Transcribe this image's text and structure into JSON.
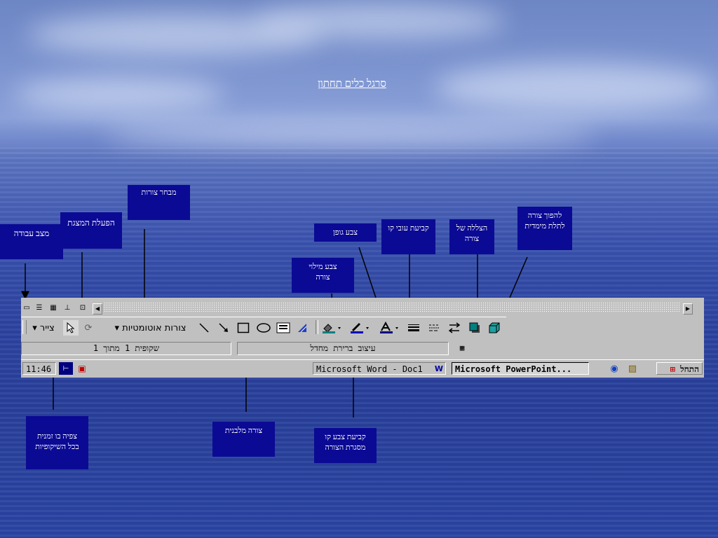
{
  "slide_title": "סרגל כלים תחתון",
  "labels": {
    "shapes_selector": "מבחר צורות",
    "work_mode": "מצב עבודה",
    "run_show": "הפעלת המצגת",
    "font_color": "צבע גופן",
    "fill_color": "צבע מילוי צורה",
    "line_thickness": "קביעת עובי קו",
    "shadow": "הצללה של צורה",
    "three_d": "להפוך צורה לתלת מימדית",
    "preview_transparencies": "צפיה בו זמנית בכל השיקופיות",
    "rectangle": "צורה מלבנית",
    "line_color": "קביעת צבע קו מסגרת הצורה"
  },
  "toolbar": {
    "draw_menu": "צייר",
    "autoshapes_menu": "צורות אוטומטיות",
    "dropdown_arrow": "▾"
  },
  "status_bar": {
    "slide_indicator": "שקופית 1 מתוך 1",
    "design_name": "עיצוב ברירת מחדל"
  },
  "taskbar": {
    "clock": "11:46",
    "word_button": "Microsoft Word - Doc1",
    "powerpoint_button": "Microsoft PowerPoint...",
    "start_button": "התחל"
  },
  "colors": {
    "label_bg": "#0b0a94",
    "fill_color_swatch": "#008080",
    "line_color_swatch": "#0000c0",
    "font_color_swatch": "#000080"
  },
  "icons": {
    "scroll_left": "◀",
    "scroll_right": "▶"
  }
}
